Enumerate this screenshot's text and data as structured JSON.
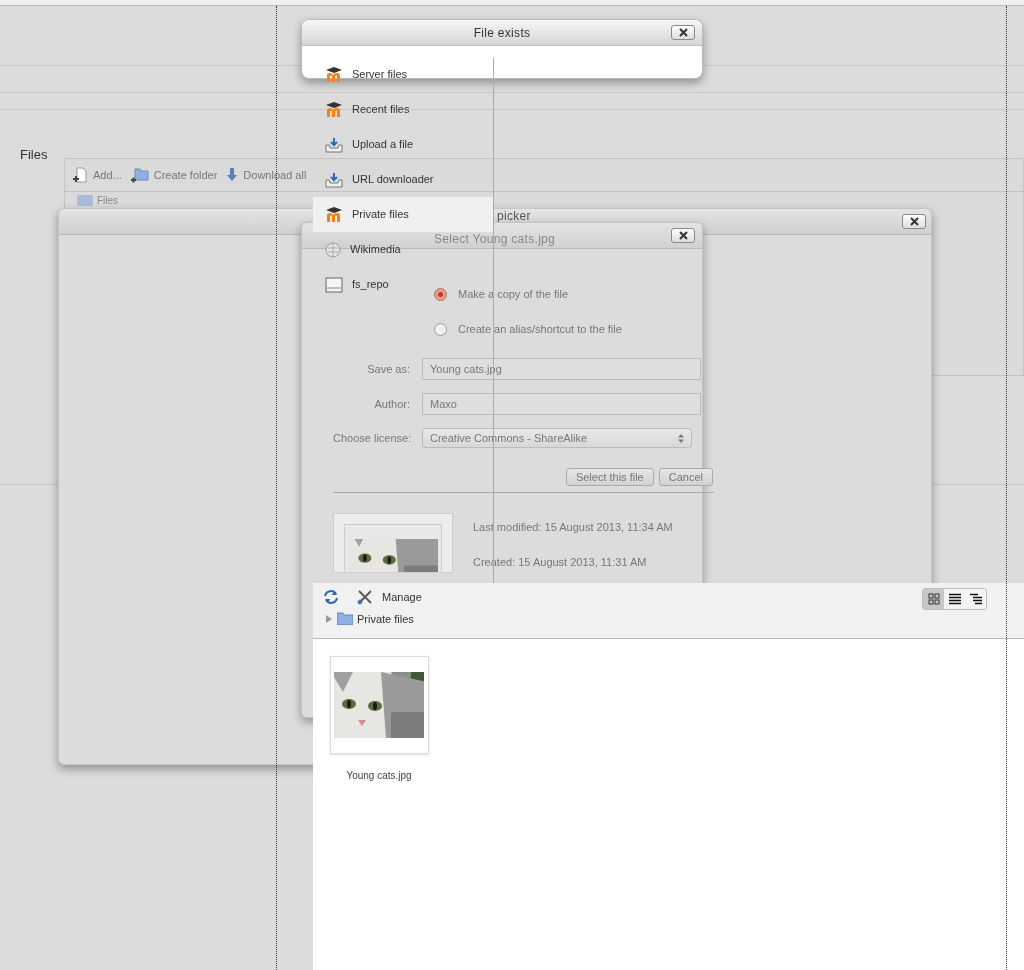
{
  "page": {
    "heading": "Files"
  },
  "file_manager": {
    "toolbar": [
      {
        "label": "Add...",
        "kind": "add"
      },
      {
        "label": "Create folder",
        "kind": "folder"
      },
      {
        "label": "Download all",
        "kind": "download"
      }
    ],
    "tree": [
      "Files"
    ]
  },
  "file_picker": {
    "title": "picker"
  },
  "select_dialog": {
    "title": "Select Young cats.jpg",
    "options": [
      {
        "label": "Make a copy of the file",
        "selected": true
      },
      {
        "label": "Create an alias/shortcut to the file",
        "selected": false
      }
    ],
    "fields": [
      {
        "label": "Save as:",
        "value": "Young cats.jpg",
        "kind": "text"
      },
      {
        "label": "Author:",
        "value": "Maxo",
        "kind": "text"
      },
      {
        "label": "Choose license:",
        "value": "Creative Commons - ShareAlike",
        "kind": "select"
      }
    ],
    "buttons": [
      "Select this file",
      "Cancel"
    ],
    "details": [
      "Last modified: 15 August 2013, 11:34 AM",
      "Created: 15 August 2013, 11:31 AM"
    ]
  },
  "file_exists": {
    "title": "File exists"
  },
  "repositories": [
    {
      "label": "Server files",
      "kind": "moodle",
      "selected": false
    },
    {
      "label": "Recent files",
      "kind": "moodle",
      "selected": false
    },
    {
      "label": "Upload a file",
      "kind": "upload",
      "selected": false
    },
    {
      "label": "URL downloader",
      "kind": "upload",
      "selected": false
    },
    {
      "label": "Private files",
      "kind": "moodle",
      "selected": true
    },
    {
      "label": "Wikimedia",
      "kind": "globe",
      "selected": false
    },
    {
      "label": "fs_repo",
      "kind": "drive",
      "selected": false
    }
  ],
  "browser": {
    "manage": "Manage",
    "path": "Private files",
    "view_modes": [
      {
        "kind": "icons",
        "selected": true
      },
      {
        "kind": "list",
        "selected": false
      },
      {
        "kind": "tree",
        "selected": false
      }
    ],
    "files": [
      {
        "name": "Young cats.jpg"
      }
    ]
  }
}
